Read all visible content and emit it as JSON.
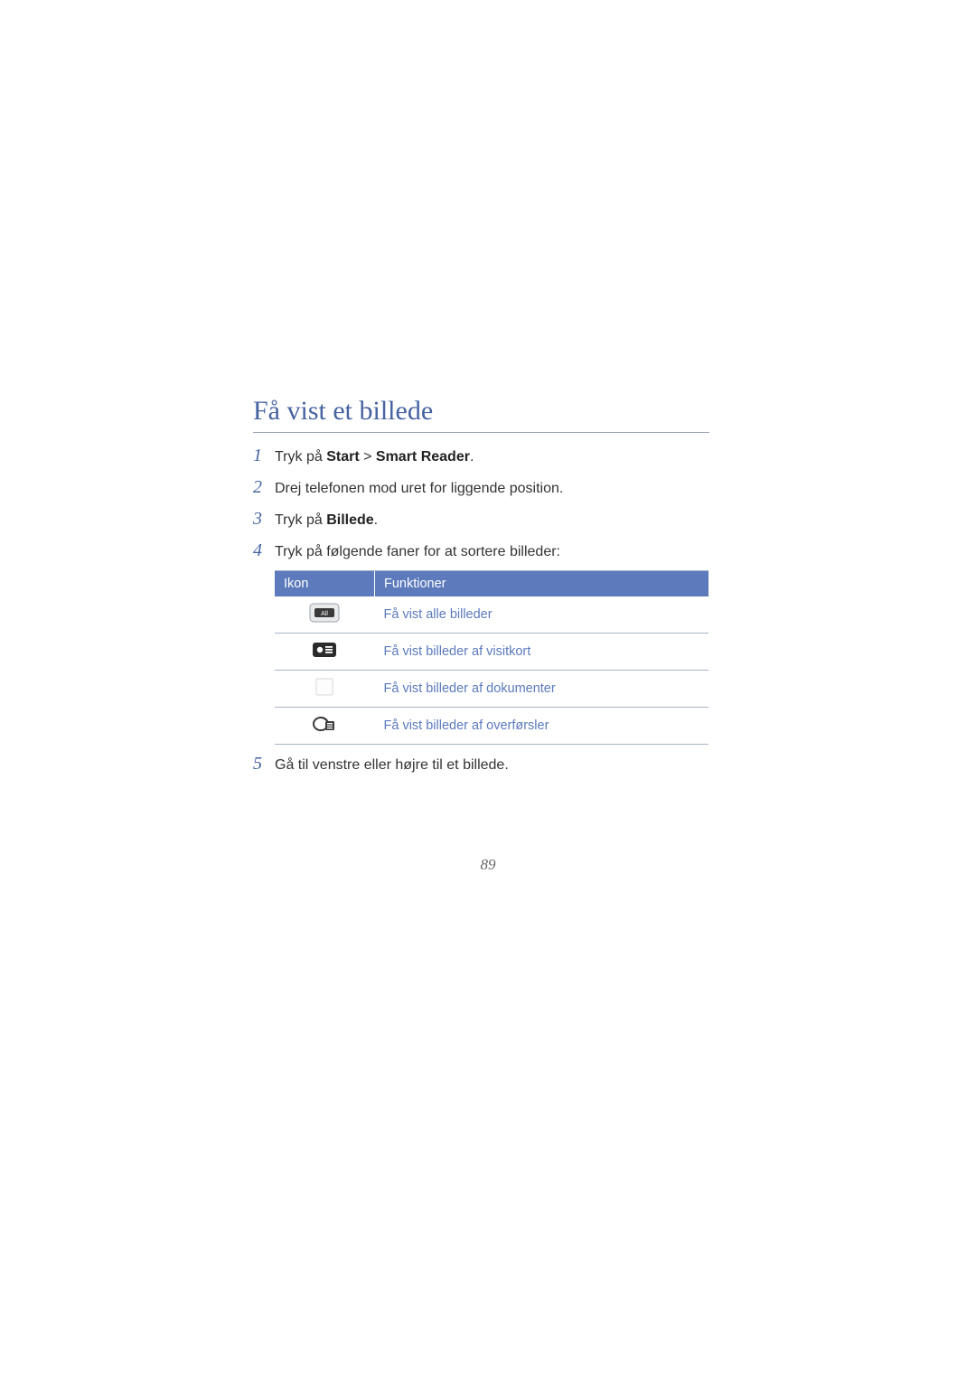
{
  "heading": "Få vist et billede",
  "steps": [
    {
      "n": "1",
      "pre": "Tryk på ",
      "bold1": "Start",
      "mid": " > ",
      "bold2": "Smart Reader",
      "post": "."
    },
    {
      "n": "2",
      "plain": "Drej telefonen mod uret for liggende position."
    },
    {
      "n": "3",
      "pre": "Tryk på ",
      "bold1": "Billede",
      "post": "."
    },
    {
      "n": "4",
      "plain": "Tryk på følgende faner for at sortere billeder:"
    }
  ],
  "table": {
    "headers": {
      "icon": "Ikon",
      "func": "Funktioner"
    },
    "rows": [
      {
        "icon": "all",
        "func": "Få vist alle billeder"
      },
      {
        "icon": "card",
        "func": "Få vist billeder af visitkort"
      },
      {
        "icon": "doc",
        "func": "Få vist billeder af dokumenter"
      },
      {
        "icon": "transfer",
        "func": "Få vist billeder af overførsler"
      }
    ]
  },
  "step5": {
    "n": "5",
    "plain": "Gå til venstre eller højre til et billede."
  },
  "page_number": "89"
}
